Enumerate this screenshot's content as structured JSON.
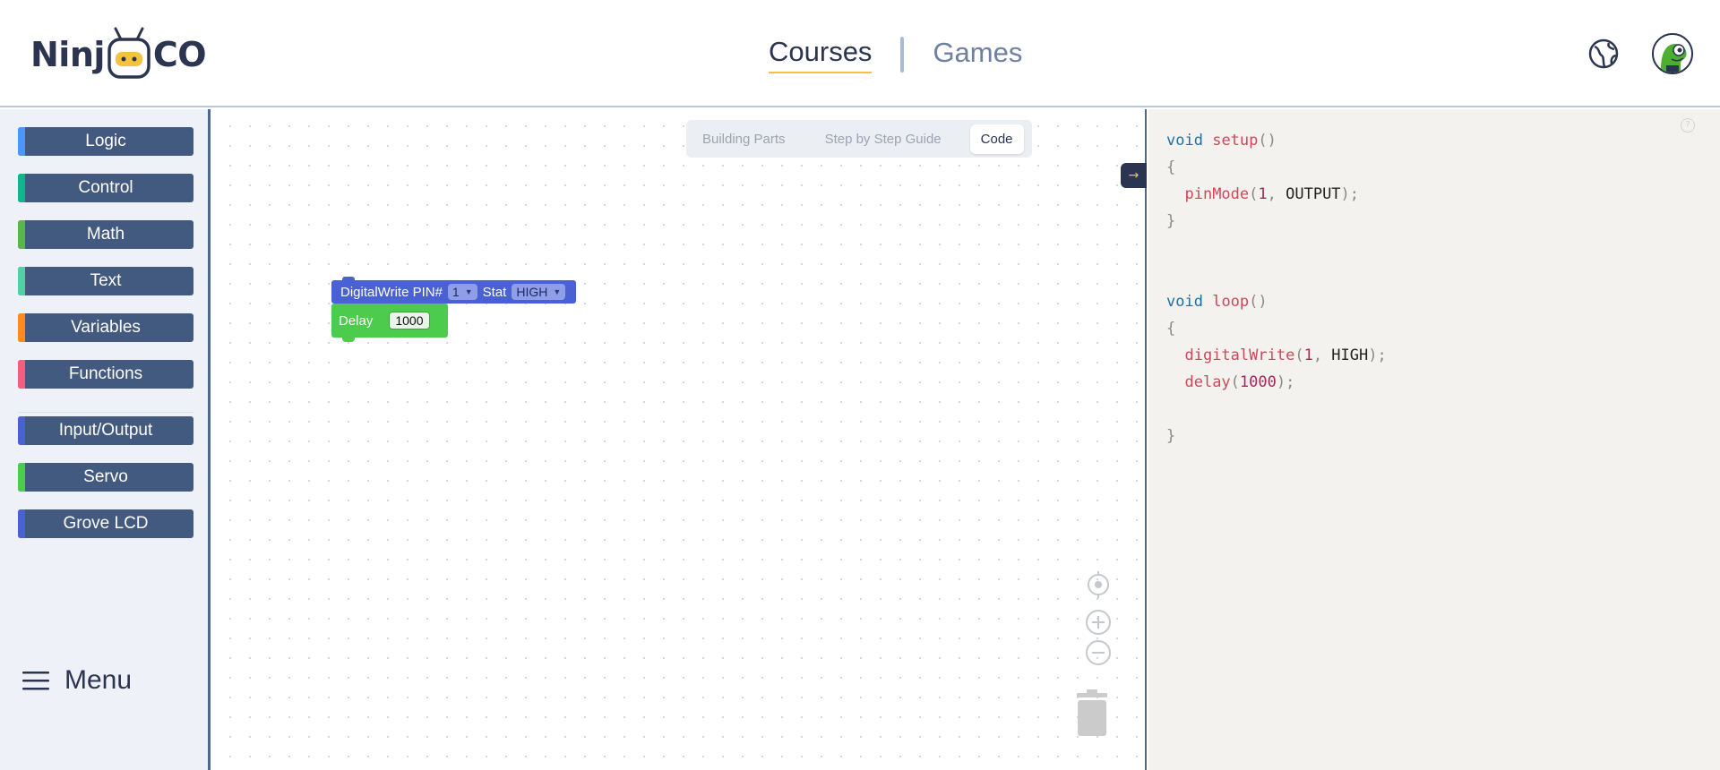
{
  "brand": {
    "logo_left": "Ninj",
    "logo_right": "CO"
  },
  "nav": {
    "courses": "Courses",
    "games": "Games"
  },
  "categories": [
    {
      "label": "Logic",
      "color": "#4c97ff"
    },
    {
      "label": "Control",
      "color": "#10b58e"
    },
    {
      "label": "Math",
      "color": "#5ab54a"
    },
    {
      "label": "Text",
      "color": "#4fd1a5"
    },
    {
      "label": "Variables",
      "color": "#ff8c1a"
    },
    {
      "label": "Functions",
      "color": "#f25f7a"
    },
    {
      "label": "Input/Output",
      "color": "#4a61d3"
    },
    {
      "label": "Servo",
      "color": "#4ccc4c"
    },
    {
      "label": "Grove LCD",
      "color": "#4a61d3"
    }
  ],
  "menu": {
    "label": "Menu"
  },
  "workspace_tabs": {
    "building_parts": "Building Parts",
    "guide": "Step by Step Guide",
    "code": "Code"
  },
  "blocks": {
    "digitalwrite": {
      "label": "DigitalWrite PIN#",
      "pin": "1",
      "stat_label": "Stat",
      "stat": "HIGH"
    },
    "delay": {
      "label": "Delay",
      "value": "1000"
    }
  },
  "code": {
    "void": "void",
    "setup": "setup",
    "loop": "loop",
    "pinMode": "pinMode",
    "pin": "1",
    "output": "OUTPUT",
    "digitalWrite": "digitalWrite",
    "high": "HIGH",
    "delay": "delay",
    "delay_ms": "1000"
  },
  "icons": {
    "globe": "globe-icon",
    "avatar": "dino-avatar",
    "collapse": "arrow-right-icon",
    "recenter": "target-icon",
    "zoom_in": "zoom-in-icon",
    "zoom_out": "zoom-out-icon",
    "trash": "trash-icon",
    "help": "help-icon",
    "menu": "hamburger-icon"
  }
}
